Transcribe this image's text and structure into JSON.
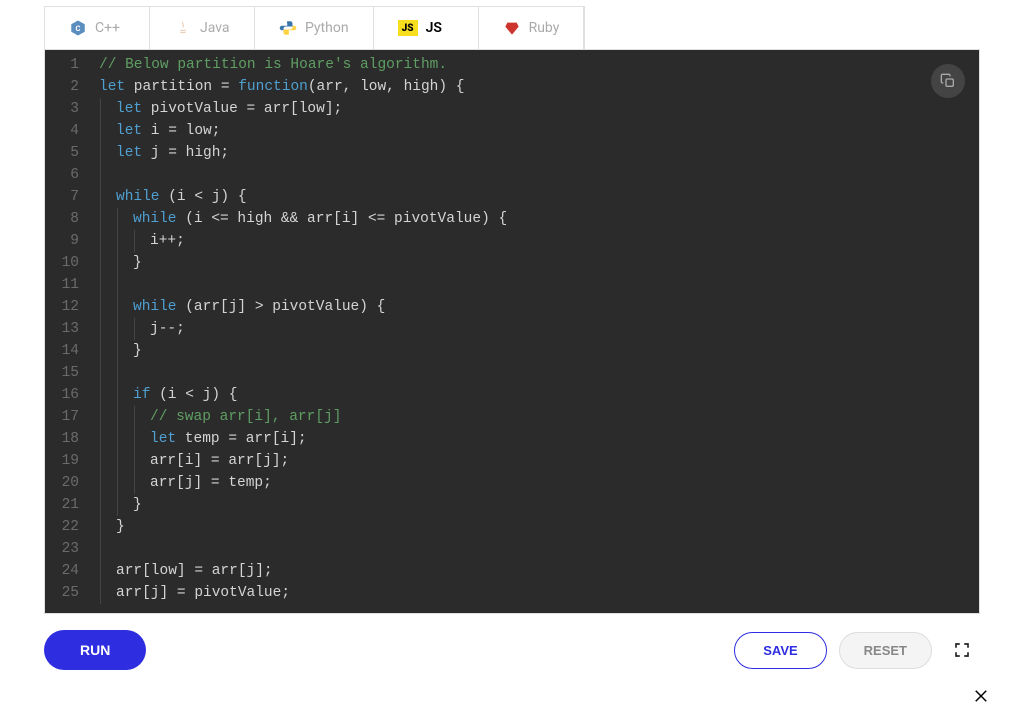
{
  "tabs": [
    {
      "label": "C++",
      "icon": "cpp-icon"
    },
    {
      "label": "Java",
      "icon": "java-icon"
    },
    {
      "label": "Python",
      "icon": "python-icon"
    },
    {
      "label": "JS",
      "icon": "js-icon",
      "active": true
    },
    {
      "label": "Ruby",
      "icon": "ruby-icon"
    }
  ],
  "editor": {
    "language": "javascript",
    "line_start": 1,
    "code_lines": [
      {
        "n": 1,
        "tokens": [
          {
            "t": "// Below partition is Hoare's algorithm.",
            "c": "comment"
          }
        ]
      },
      {
        "n": 2,
        "tokens": [
          {
            "t": "let",
            "c": "keyword"
          },
          {
            "t": " partition = ",
            "c": "ident"
          },
          {
            "t": "function",
            "c": "keyword"
          },
          {
            "t": "(arr, low, high) {",
            "c": "ident"
          }
        ]
      },
      {
        "n": 3,
        "indent": 1,
        "tokens": [
          {
            "t": "let",
            "c": "keyword"
          },
          {
            "t": " pivotValue = arr[low];",
            "c": "ident"
          }
        ]
      },
      {
        "n": 4,
        "indent": 1,
        "tokens": [
          {
            "t": "let",
            "c": "keyword"
          },
          {
            "t": " i = low;",
            "c": "ident"
          }
        ]
      },
      {
        "n": 5,
        "indent": 1,
        "tokens": [
          {
            "t": "let",
            "c": "keyword"
          },
          {
            "t": " j = high;",
            "c": "ident"
          }
        ]
      },
      {
        "n": 6,
        "indent": 1,
        "tokens": []
      },
      {
        "n": 7,
        "indent": 1,
        "tokens": [
          {
            "t": "while",
            "c": "keyword"
          },
          {
            "t": " (i < j) {",
            "c": "ident"
          }
        ]
      },
      {
        "n": 8,
        "indent": 2,
        "tokens": [
          {
            "t": "while",
            "c": "keyword"
          },
          {
            "t": " (i <= high && arr[i] <= pivotValue) {",
            "c": "ident"
          }
        ]
      },
      {
        "n": 9,
        "indent": 3,
        "tokens": [
          {
            "t": "i++;",
            "c": "ident"
          }
        ]
      },
      {
        "n": 10,
        "indent": 2,
        "tokens": [
          {
            "t": "}",
            "c": "ident"
          }
        ]
      },
      {
        "n": 11,
        "indent": 2,
        "tokens": []
      },
      {
        "n": 12,
        "indent": 2,
        "tokens": [
          {
            "t": "while",
            "c": "keyword"
          },
          {
            "t": " (arr[j] > pivotValue) {",
            "c": "ident"
          }
        ]
      },
      {
        "n": 13,
        "indent": 3,
        "tokens": [
          {
            "t": "j--;",
            "c": "ident"
          }
        ]
      },
      {
        "n": 14,
        "indent": 2,
        "tokens": [
          {
            "t": "}",
            "c": "ident"
          }
        ]
      },
      {
        "n": 15,
        "indent": 2,
        "tokens": []
      },
      {
        "n": 16,
        "indent": 2,
        "tokens": [
          {
            "t": "if",
            "c": "keyword"
          },
          {
            "t": " (i < j) {",
            "c": "ident"
          }
        ]
      },
      {
        "n": 17,
        "indent": 3,
        "tokens": [
          {
            "t": "// swap arr[i], arr[j]",
            "c": "comment"
          }
        ]
      },
      {
        "n": 18,
        "indent": 3,
        "tokens": [
          {
            "t": "let",
            "c": "keyword"
          },
          {
            "t": " temp = arr[i];",
            "c": "ident"
          }
        ]
      },
      {
        "n": 19,
        "indent": 3,
        "tokens": [
          {
            "t": "arr[i] = arr[j];",
            "c": "ident"
          }
        ]
      },
      {
        "n": 20,
        "indent": 3,
        "tokens": [
          {
            "t": "arr[j] = temp;",
            "c": "ident"
          }
        ]
      },
      {
        "n": 21,
        "indent": 2,
        "tokens": [
          {
            "t": "}",
            "c": "ident"
          }
        ]
      },
      {
        "n": 22,
        "indent": 1,
        "tokens": [
          {
            "t": "}",
            "c": "ident"
          }
        ]
      },
      {
        "n": 23,
        "indent": 1,
        "tokens": []
      },
      {
        "n": 24,
        "indent": 1,
        "tokens": [
          {
            "t": "arr[low] = arr[j];",
            "c": "ident"
          }
        ]
      },
      {
        "n": 25,
        "indent": 1,
        "tokens": [
          {
            "t": "arr[j] = pivotValue;",
            "c": "ident"
          }
        ]
      }
    ]
  },
  "buttons": {
    "run": "RUN",
    "save": "SAVE",
    "reset": "RESET"
  },
  "icons": {
    "copy": "copy-icon",
    "fullscreen": "fullscreen-icon",
    "close": "close-icon"
  }
}
